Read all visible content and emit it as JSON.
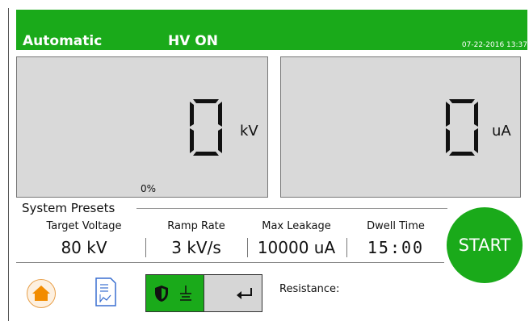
{
  "header": {
    "mode": "Automatic",
    "hv_status": "HV ON",
    "datetime": "07-22-2016 13:37",
    "color": "#1aaa1a"
  },
  "voltage_display": {
    "value": "0",
    "unit": "kV",
    "percent": "0%"
  },
  "current_display": {
    "value": "0",
    "unit": "uA"
  },
  "presets": {
    "title": "System Presets",
    "target_voltage": {
      "label": "Target Voltage",
      "value": "80 kV"
    },
    "ramp_rate": {
      "label": "Ramp Rate",
      "value": "3 kV/s"
    },
    "max_leakage": {
      "label": "Max Leakage",
      "value": "10000 uA"
    },
    "dwell_time": {
      "label": "Dwell Time",
      "value": "15:00"
    }
  },
  "start_button": {
    "label": "START",
    "color": "#1aaa1a"
  },
  "bottom": {
    "resistance_label": "Resistance:",
    "icons": [
      "home-icon",
      "document-icon",
      "shield-icon",
      "ground-icon",
      "return-icon"
    ]
  }
}
